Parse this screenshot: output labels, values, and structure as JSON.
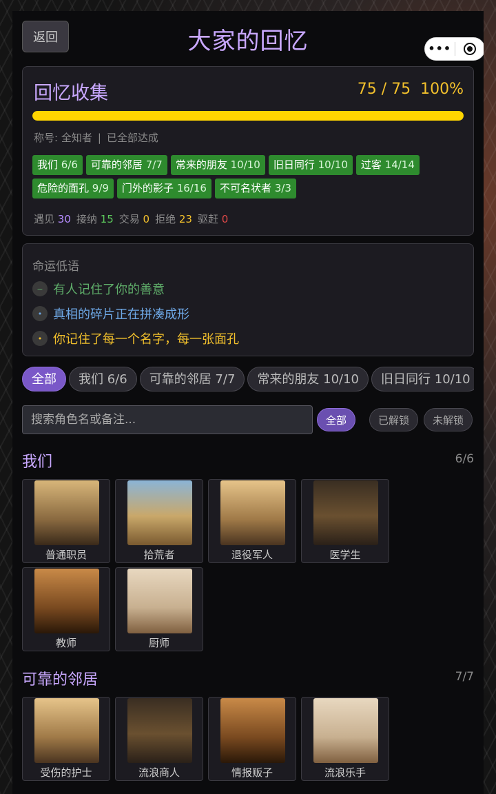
{
  "header": {
    "back_label": "返回",
    "title": "大家的回忆",
    "more_icon": "•••"
  },
  "collection": {
    "title": "回忆收集",
    "progress_text": "75 / 75",
    "percent_text": "100%",
    "progress_fraction": 1.0,
    "title_line": {
      "label": "称号: 全知者",
      "sep": "|",
      "status": "已全部达成"
    },
    "badges": [
      {
        "name": "我们",
        "count": "6/6"
      },
      {
        "name": "可靠的邻居",
        "count": "7/7"
      },
      {
        "name": "常来的朋友",
        "count": "10/10"
      },
      {
        "name": "旧日同行",
        "count": "10/10"
      },
      {
        "name": "过客",
        "count": "14/14"
      },
      {
        "name": "危险的面孔",
        "count": "9/9"
      },
      {
        "name": "门外的影子",
        "count": "16/16"
      },
      {
        "name": "不可名状者",
        "count": "3/3"
      }
    ],
    "stats": [
      {
        "label": "遇见",
        "value": "30",
        "color": "#b58cff"
      },
      {
        "label": "接纳",
        "value": "15",
        "color": "#5cc85c"
      },
      {
        "label": "交易",
        "value": "0",
        "color": "#f2c02c"
      },
      {
        "label": "拒绝",
        "value": "23",
        "color": "#f2c02c"
      },
      {
        "label": "驱赶",
        "value": "0",
        "color": "#e04848"
      }
    ]
  },
  "whisper": {
    "title": "命运低语",
    "lines": [
      {
        "icon": "~",
        "text": "有人记住了你的善意",
        "color": "#5fae6a"
      },
      {
        "icon": "•",
        "text": "真相的碎片正在拼凑成形",
        "color": "#6ea8e6"
      },
      {
        "icon": "•",
        "text": "你记住了每一个名字，每一张面孔",
        "color": "#f2c02c"
      }
    ]
  },
  "filters": [
    "全部",
    "我们 6/6",
    "可靠的邻居 7/7",
    "常来的朋友 10/10",
    "旧日同行 10/10"
  ],
  "search": {
    "placeholder": "搜索角色名或备注..."
  },
  "segments": [
    "全部",
    "已解锁",
    "未解锁"
  ],
  "sections": [
    {
      "name": "我们",
      "count": "6/6",
      "characters": [
        "普通职员",
        "拾荒者",
        "退役军人",
        "医学生",
        "教师",
        "厨师"
      ]
    },
    {
      "name": "可靠的邻居",
      "count": "7/7",
      "characters": [
        "受伤的护士",
        "流浪商人",
        "情报贩子",
        "流浪乐手"
      ]
    }
  ]
}
